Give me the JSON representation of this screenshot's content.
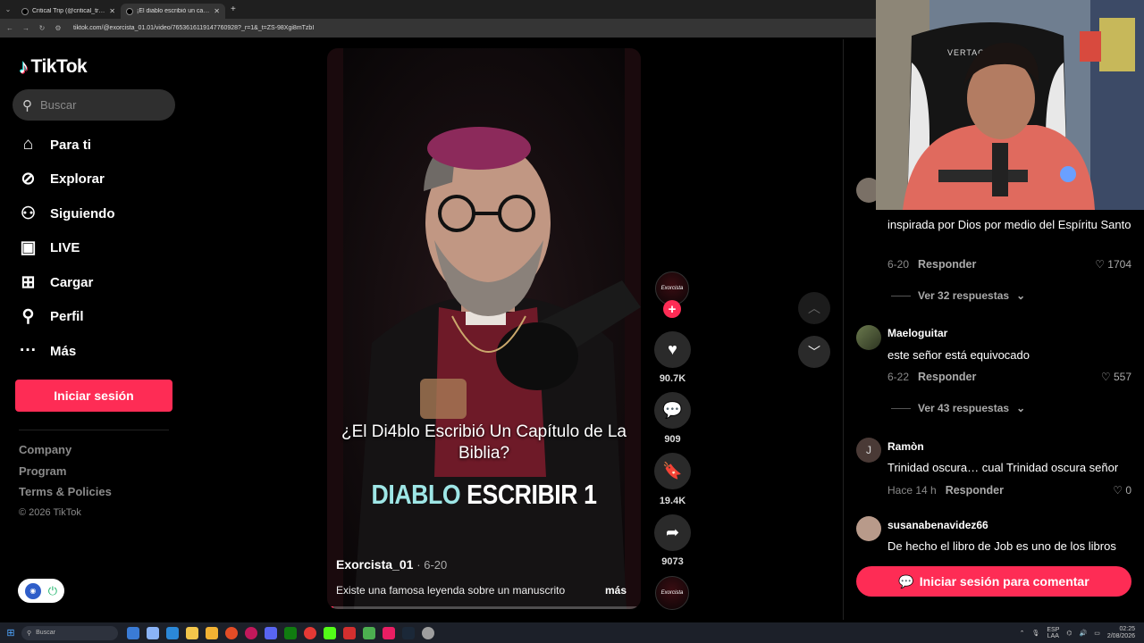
{
  "browser": {
    "tabs": [
      {
        "title": "Critical Trip (@critical_trip2) | TikTok",
        "active": false
      },
      {
        "title": "¡El diablo escribió un capítulo de la Biblia?",
        "active": true
      }
    ],
    "url": "tiktok.com/@exorcista_01.01/video/7653616119147760928?_r=1&_t=ZS-98Xgi8mTzbI"
  },
  "sidebar": {
    "logo": "TikTok",
    "search_placeholder": "Buscar",
    "items": [
      {
        "label": "Para ti",
        "icon": "home-icon"
      },
      {
        "label": "Explorar",
        "icon": "compass-icon"
      },
      {
        "label": "Siguiendo",
        "icon": "following-icon"
      },
      {
        "label": "LIVE",
        "icon": "live-icon"
      },
      {
        "label": "Cargar",
        "icon": "upload-icon"
      },
      {
        "label": "Perfil",
        "icon": "profile-icon"
      },
      {
        "label": "Más",
        "icon": "more-icon"
      }
    ],
    "login_label": "Iniciar sesión",
    "footer": [
      "Company",
      "Program",
      "Terms & Policies"
    ],
    "copyright": "© 2026 TikTok"
  },
  "video": {
    "overlay_question": "¿El Di4blo Escribió Un Capítulo de La Biblia?",
    "overlay_word1": "DIABLO",
    "overlay_word2": "ESCRIBIR 1",
    "author": "Exorcista_01",
    "date": "· 6-20",
    "description": "Existe una famosa leyenda sobre un manuscrito",
    "more_label": "más",
    "avatar_label": "Exorcista",
    "progress": 0.02
  },
  "actions": {
    "likes": "90.7K",
    "comments": "909",
    "saves": "19.4K",
    "shares": "9073"
  },
  "comments": [
    {
      "user": "",
      "text": "inspirada por Dios por medio del Espíritu Santo",
      "date": "6-20",
      "reply": "Responder",
      "likes": "1704",
      "view_replies": "Ver 32 respuestas"
    },
    {
      "user": "Maeloguitar",
      "text": "este señor está equivocado",
      "date": "6-22",
      "reply": "Responder",
      "likes": "557",
      "view_replies": "Ver 43 respuestas"
    },
    {
      "user": "Ramòn",
      "avatar_letter": "J",
      "text": "Trinidad oscura… cual Trinidad oscura señor",
      "date": "Hace 14 h",
      "reply": "Responder",
      "likes": "0"
    },
    {
      "user": "susanabenavidez66",
      "text": "De hecho el libro de Job es uno de los libros"
    }
  ],
  "comment_login_label": "Iniciar sesión para comentar",
  "webcam": {
    "chair_brand": "VERTAGEAR"
  },
  "taskbar": {
    "search_label": "Buscar",
    "lang": "ESP",
    "lang2": "LAA",
    "time": "02:25",
    "date": "2/08/2026"
  },
  "colors": {
    "accent": "#fe2c55",
    "background": "#000000"
  }
}
